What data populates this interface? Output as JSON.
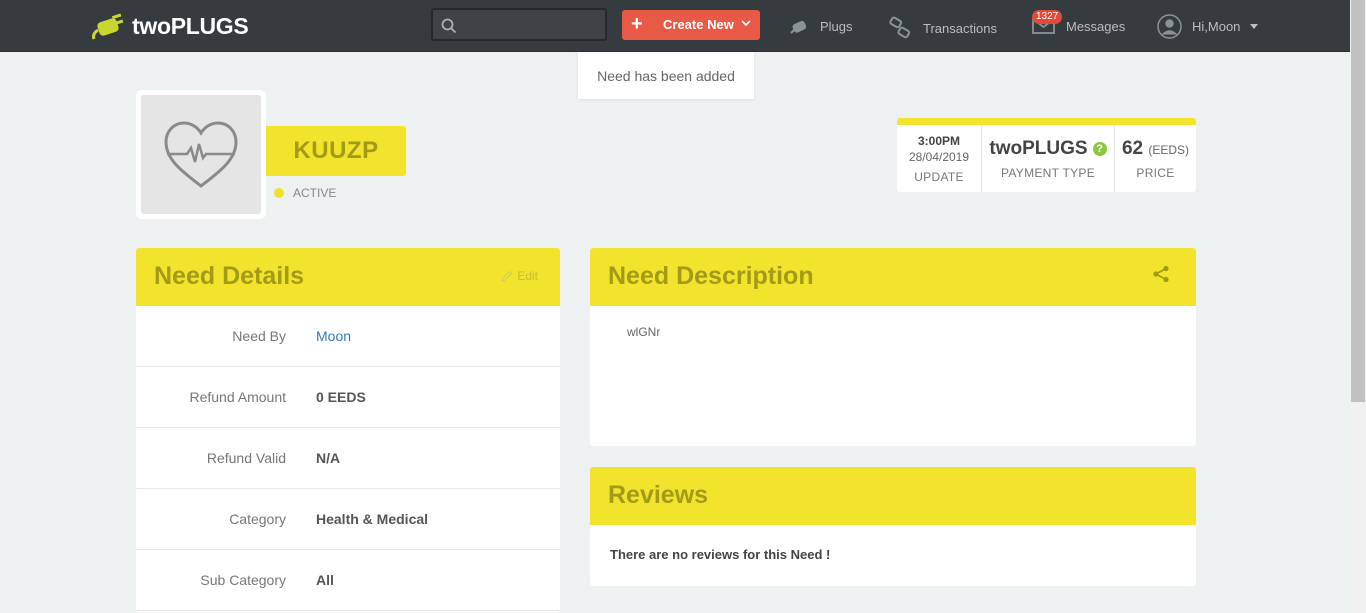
{
  "topbar": {
    "logo_text": "twoPLUGS",
    "search": {
      "placeholder": "",
      "value": ""
    },
    "create_label": "Create New",
    "nav": {
      "plugs": "Plugs",
      "transactions": "Transactions",
      "messages": "Messages",
      "messages_count": "1327",
      "user": "Hi,Moon"
    }
  },
  "toast": "Need has been added",
  "profile": {
    "name": "KUUZP",
    "status": "ACTIVE",
    "avatar_icon": "heart-pulse-icon"
  },
  "info": {
    "update_time": "3:00PM",
    "update_date": "28/04/2019",
    "update_label": "UPDATE",
    "payment_type": "twoPLUGS",
    "payment_label": "PAYMENT TYPE",
    "price": "62",
    "price_unit": "(EEDS)",
    "price_label": "PRICE"
  },
  "details": {
    "title": "Need Details",
    "edit_label": "Edit",
    "rows": [
      {
        "key": "Need By",
        "value": "Moon"
      },
      {
        "key": "Refund Amount",
        "value": "0 EEDS"
      },
      {
        "key": "Refund Valid",
        "value": "N/A"
      },
      {
        "key": "Category",
        "value": "Health & Medical"
      },
      {
        "key": "Sub Category",
        "value": "All"
      }
    ]
  },
  "description": {
    "title": "Need Description",
    "text": "wlGNr"
  },
  "reviews": {
    "title": "Reviews",
    "empty_text": "There are no reviews for this Need !"
  },
  "colors": {
    "accent_yellow": "#f2e32c",
    "topbar": "#363b3f",
    "create_button": "#e85a45",
    "link": "#337ab7"
  }
}
